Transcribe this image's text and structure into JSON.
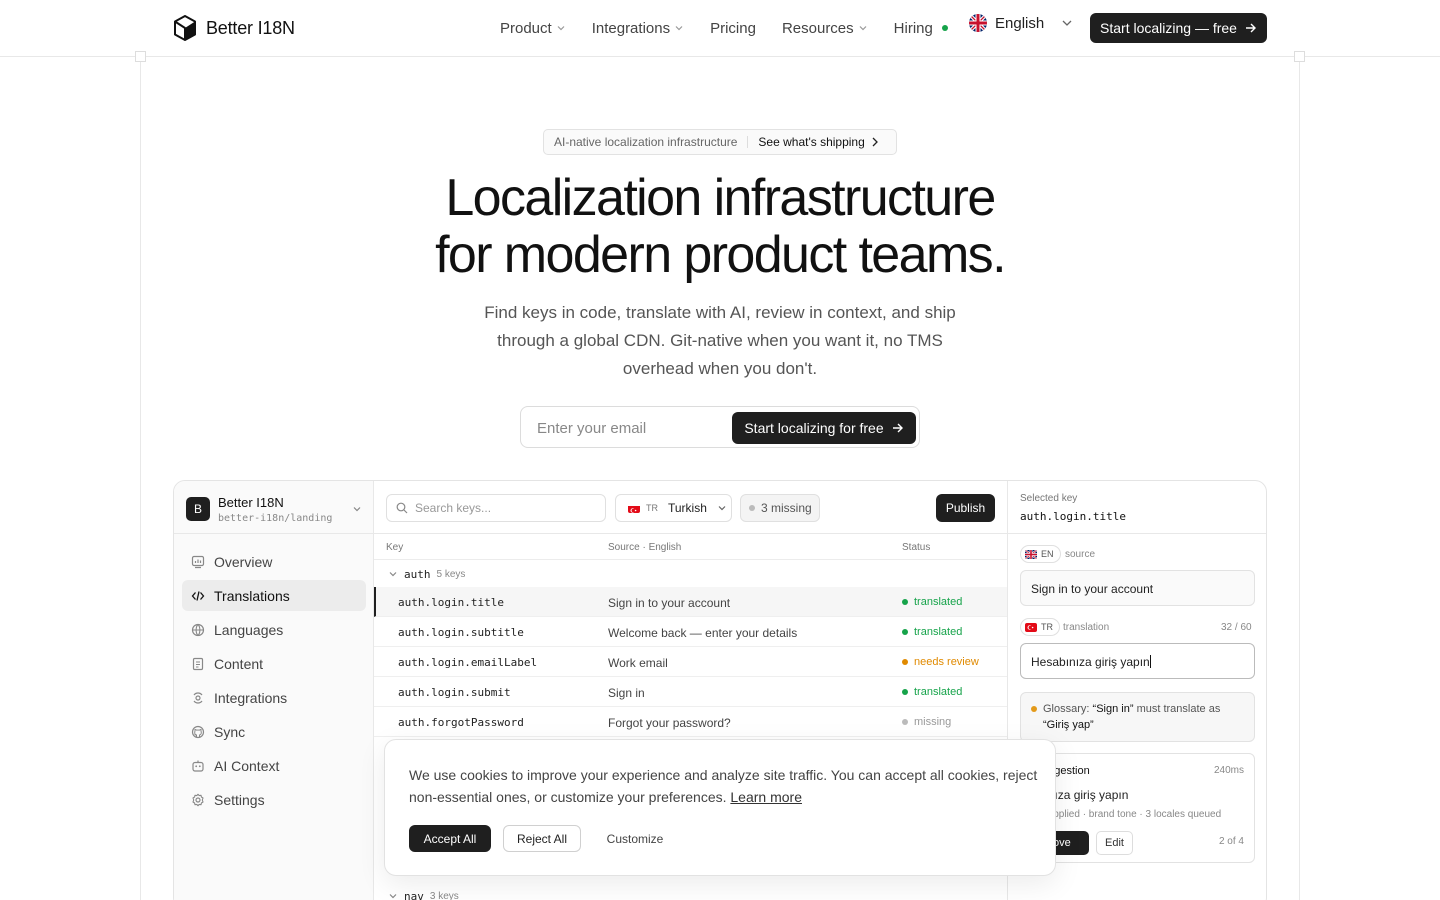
{
  "header": {
    "brand": "Better I18N",
    "nav": [
      {
        "label": "Product",
        "has_menu": true
      },
      {
        "label": "Integrations",
        "has_menu": true
      },
      {
        "label": "Pricing",
        "has_menu": false
      },
      {
        "label": "Resources",
        "has_menu": true
      },
      {
        "label": "Hiring",
        "has_menu": false
      }
    ],
    "language": "English",
    "cta": "Start localizing — free"
  },
  "hero": {
    "pill_left": "AI-native localization infrastructure",
    "pill_right": "See what's shipping",
    "title_line1": "Localization infrastructure",
    "title_line2": "for modern product teams.",
    "subtitle": "Find keys in code, translate with AI, review in context, and ship through a global CDN. Git-native when you want it, no TMS overhead when you don't.",
    "email_placeholder": "Enter your email",
    "signup_button": "Start localizing for free"
  },
  "app": {
    "workspace": {
      "badge": "B",
      "name": "Better I18N",
      "repo": "better-i18n/landing"
    },
    "sidebar": [
      {
        "label": "Overview",
        "icon": "overview-icon",
        "active": false
      },
      {
        "label": "Translations",
        "icon": "code-icon",
        "active": true
      },
      {
        "label": "Languages",
        "icon": "globe-icon",
        "active": false
      },
      {
        "label": "Content",
        "icon": "document-icon",
        "active": false
      },
      {
        "label": "Integrations",
        "icon": "integrations-icon",
        "active": false
      },
      {
        "label": "Sync",
        "icon": "github-icon",
        "active": false
      },
      {
        "label": "AI Context",
        "icon": "bot-icon",
        "active": false
      },
      {
        "label": "Settings",
        "icon": "gear-icon",
        "active": false
      }
    ],
    "toolbar": {
      "search_placeholder": "Search keys...",
      "lang_code": "TR",
      "lang_name": "Turkish",
      "missing": "3 missing",
      "publish": "Publish"
    },
    "table": {
      "columns": [
        "Key",
        "Source · English",
        "Status"
      ],
      "groups": [
        {
          "name": "auth",
          "count": "5 keys"
        },
        {
          "name": "nav",
          "count": "3 keys"
        }
      ],
      "rows": [
        {
          "key": "auth.login.title",
          "source": "Sign in to your account",
          "status": "translated",
          "color": "#16a34a"
        },
        {
          "key": "auth.login.subtitle",
          "source": "Welcome back — enter your details",
          "status": "translated",
          "color": "#16a34a"
        },
        {
          "key": "auth.login.emailLabel",
          "source": "Work email",
          "status": "needs review",
          "color": "#e08a00"
        },
        {
          "key": "auth.login.submit",
          "source": "Sign in",
          "status": "translated",
          "color": "#16a34a"
        },
        {
          "key": "auth.forgotPassword",
          "source": "Forgot your password?",
          "status": "missing",
          "color": "#aaaaaa"
        }
      ]
    },
    "detail": {
      "label": "Selected key",
      "key": "auth.login.title",
      "source_code": "EN",
      "source_caption": "source",
      "source_text": "Sign in to your account",
      "target_code": "TR",
      "target_caption": "translation",
      "char_count": "32 / 60",
      "target_text": "Hesabınıza giriş yapın",
      "glossary_prefix": "Glossary:",
      "glossary_term": "“Sign in”",
      "glossary_mid": "must translate as",
      "glossary_target": "“Giriş yap”",
      "ai_title": "l suggestion",
      "ai_time": "240ms",
      "ai_text": "abınıza giriş yapın",
      "ai_meta": "ary applied · brand tone · 3 locales queued",
      "ai_approve": "rove",
      "ai_edit": "Edit",
      "ai_count": "2 of 4"
    }
  },
  "cookie": {
    "text": "We use cookies to improve your experience and analyze site traffic. You can accept all cookies, reject non-essential ones, or customize your preferences.",
    "link": "Learn more",
    "accept": "Accept All",
    "reject": "Reject All",
    "customize": "Customize"
  }
}
